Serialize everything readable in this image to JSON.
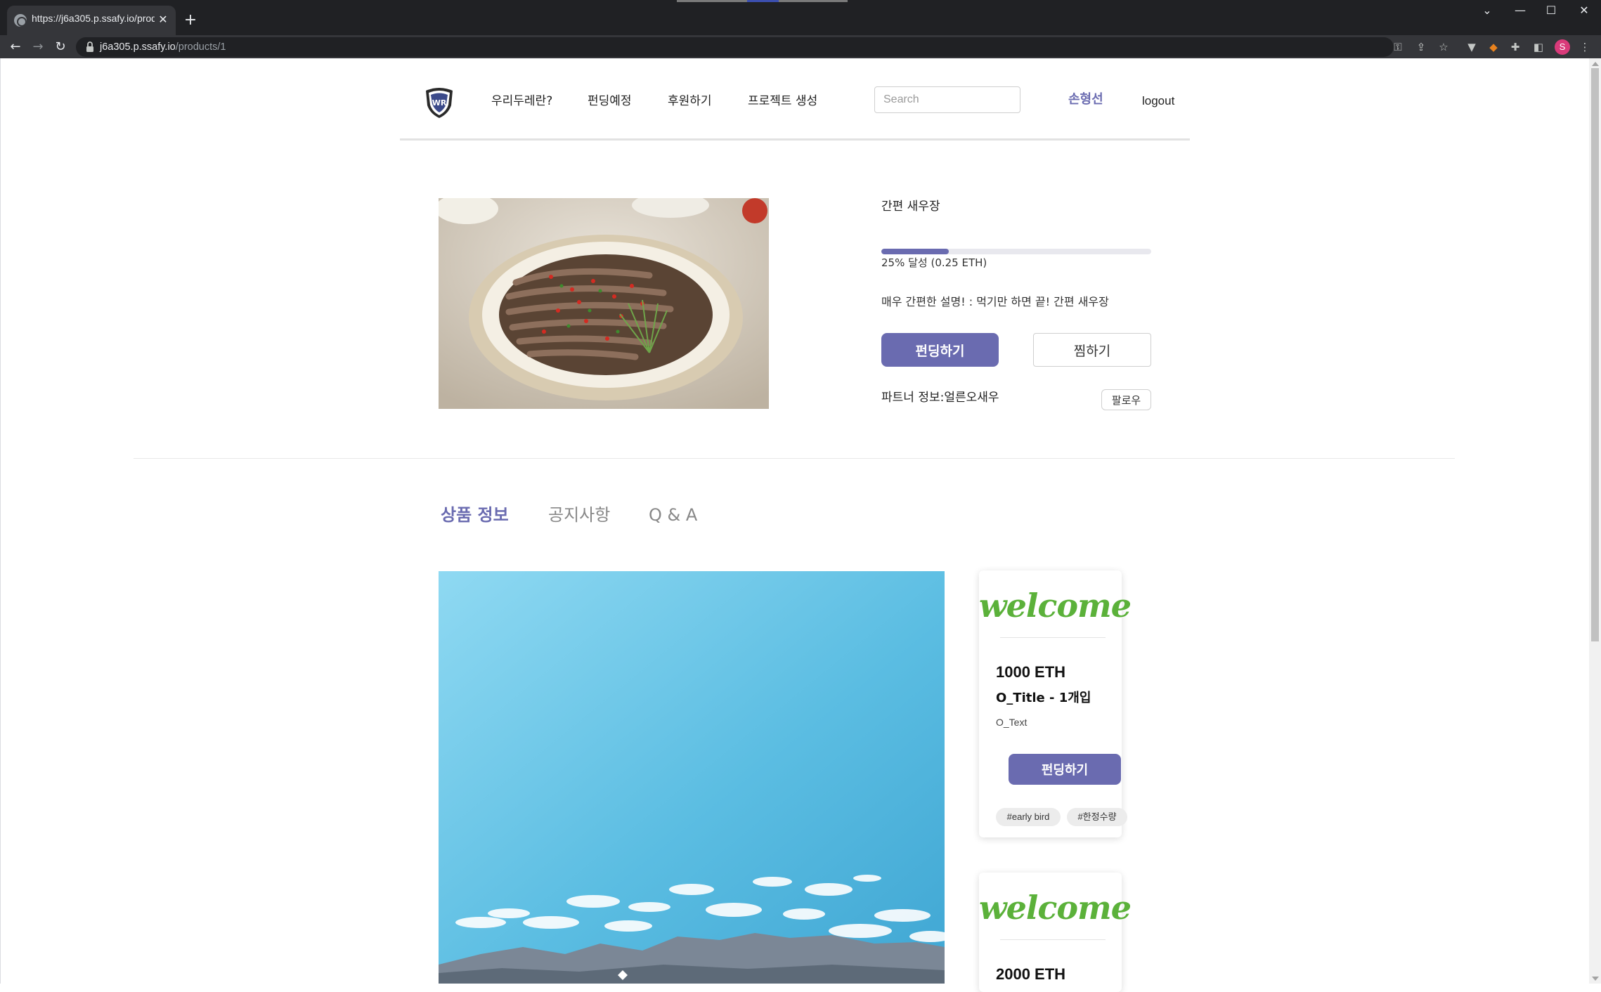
{
  "browser": {
    "tab_title": "https://j6a305.p.ssafy.io/products/1",
    "tab_close": "✕",
    "new_tab": "+",
    "url_host": "j6a305.p.ssafy.io",
    "url_path": "/products/1",
    "profile_initial": "S",
    "icons": [
      "globe-icon",
      "lock-icon",
      "key-icon",
      "share-icon",
      "star-icon",
      "puzzle-icon",
      "side-panel-icon",
      "menu-icon"
    ]
  },
  "header": {
    "nav": [
      "우리두레란?",
      "펀딩예정",
      "후원하기",
      "프로젝트 생성"
    ],
    "search_placeholder": "Search",
    "user_name": "손형선",
    "logout": "logout"
  },
  "product": {
    "title": "간편 새우장",
    "progress_percent": 25,
    "progress_text": "25% 달성 (0.25 ETH)",
    "description": "매우 간편한 설명! : 먹기만 하면 끝! 간편 새우장",
    "fund_button": "펀딩하기",
    "wish_button": "찜하기",
    "partner_info": "파트너 정보:얼른오새우",
    "follow_button": "팔로우"
  },
  "tabs": [
    "상품 정보",
    "공지사항",
    "Q & A"
  ],
  "rewards": [
    {
      "welcome": "welcome",
      "price": "1000 ETH",
      "title": "O_Title - 1개입",
      "text": "O_Text",
      "button": "펀딩하기",
      "tags": [
        "#early bird",
        "#한정수량"
      ]
    },
    {
      "welcome": "welcome",
      "price": "2000 ETH"
    }
  ],
  "colors": {
    "accent": "#6a6bb0",
    "welcome_green": "#5bb13a",
    "chrome_dark": "#202124",
    "chrome_mid": "#35363a"
  }
}
